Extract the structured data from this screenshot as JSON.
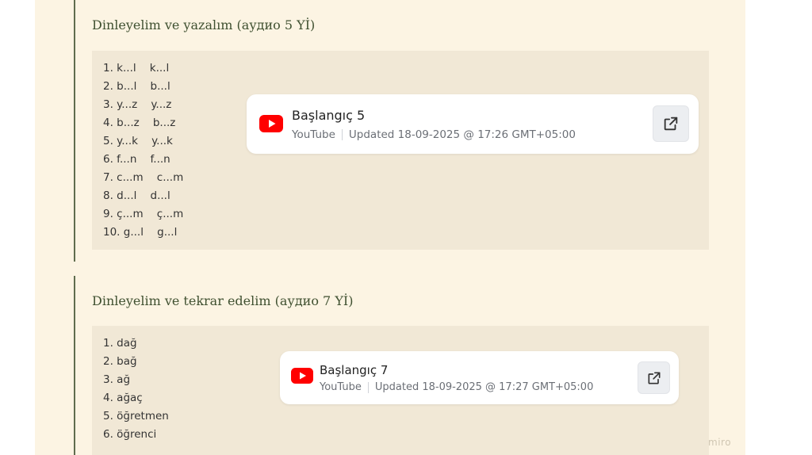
{
  "section1": {
    "heading": "Dinleyelim ve yazalım (аудио 5 Yİ)",
    "items": [
      "1. k...l    k...l",
      "2. b...l    b...l",
      "3. y...z    y...z",
      "4. b...z    b...z",
      "5. y...k    y...k",
      "6. f...n    f...n",
      "7. c...m    c...m",
      "8. d...l    d...l",
      "9. ç...m    ç...m",
      "10. g...l    g...l"
    ],
    "card": {
      "title": "Başlangıç 5",
      "source": "YouTube",
      "updated": "Updated 18-09-2025 @ 17:26 GMT+05:00"
    }
  },
  "section2": {
    "heading": "Dinleyelim ve tekrar edelim (аудио 7 Yİ)",
    "items": [
      "1. dağ",
      "2. bağ",
      "3. ağ",
      "4. ağaç",
      "5. öğretmen",
      "6. öğrenci"
    ],
    "card": {
      "title": "Başlangıç 7",
      "source": "YouTube",
      "updated": "Updated 18-09-2025 @ 17:27 GMT+05:00"
    }
  },
  "watermark": "miro",
  "colors": {
    "youtube_red": "#ff0000",
    "heading": "#3f5030",
    "board": "#fcf4e3",
    "panel": "#f1e8d6"
  },
  "icons": {
    "video": "youtube-icon",
    "open": "external-link-icon"
  }
}
